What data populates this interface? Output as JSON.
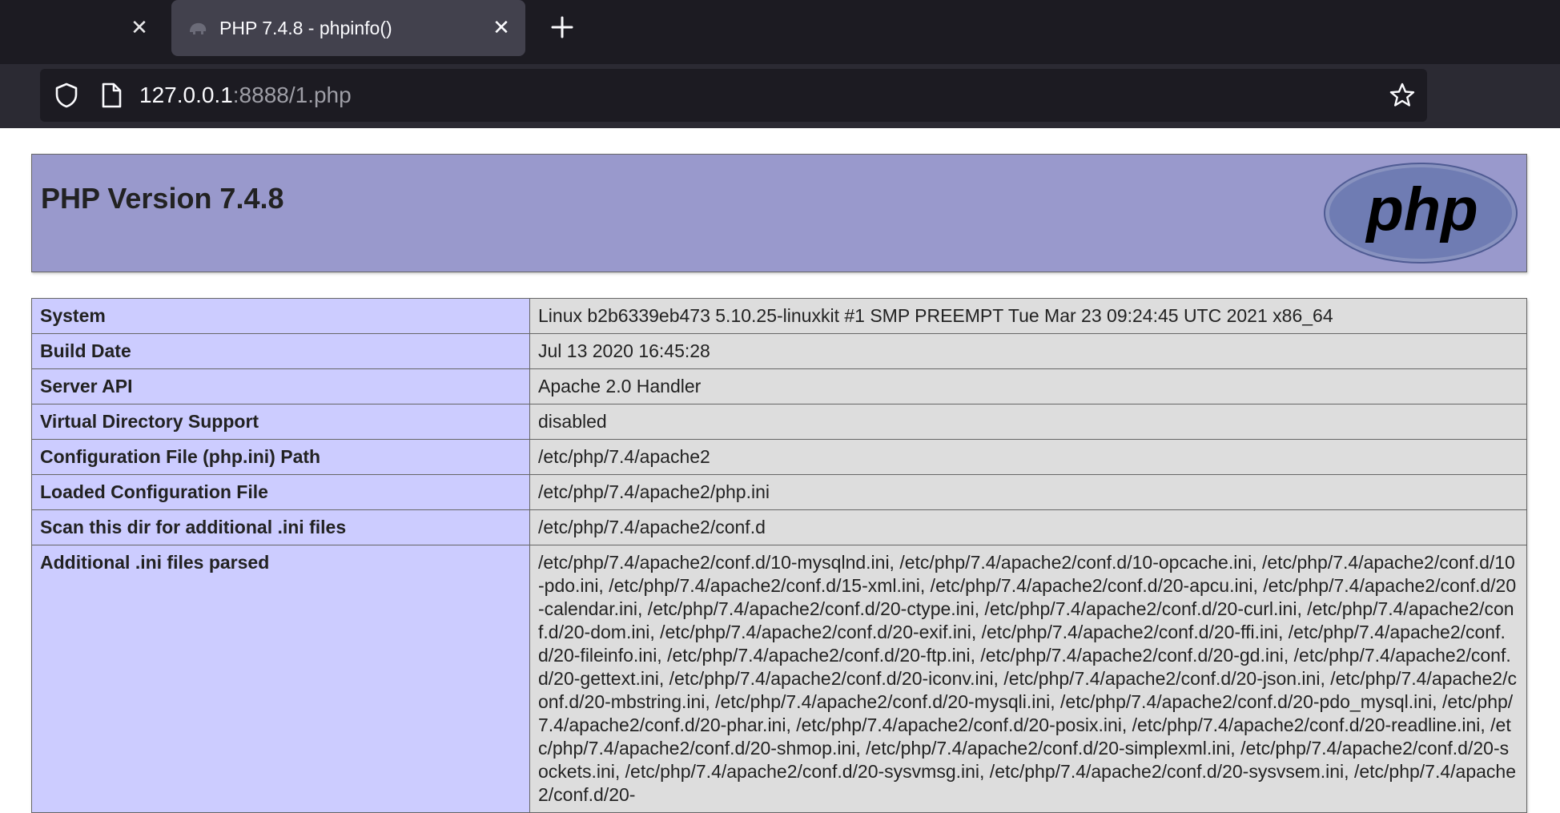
{
  "browser": {
    "tabs": [
      {
        "title": "PHP 7.4.8 - phpinfo()",
        "active": true
      }
    ],
    "url": {
      "host": "127.0.0.1",
      "rest": ":8888/1.php"
    },
    "icons": {
      "prev_tab_close": "close-icon",
      "favicon": "php-elephant-favicon",
      "tab_close": "close-icon",
      "new_tab": "plus-icon",
      "shield": "shield-icon",
      "page": "page-icon",
      "bookmark": "star-icon"
    }
  },
  "page": {
    "title": "PHP Version 7.4.8",
    "logo": "php",
    "colors": {
      "header_bg": "#9999cc",
      "label_bg": "#ccccff",
      "value_bg": "#dddddd",
      "border": "#666666",
      "logo_fill": "#6f7cb3",
      "logo_text": "#000000"
    },
    "rows": [
      {
        "label": "System",
        "value": "Linux b2b6339eb473 5.10.25-linuxkit #1 SMP PREEMPT Tue Mar 23 09:24:45 UTC 2021 x86_64"
      },
      {
        "label": "Build Date",
        "value": "Jul 13 2020 16:45:28"
      },
      {
        "label": "Server API",
        "value": "Apache 2.0 Handler"
      },
      {
        "label": "Virtual Directory Support",
        "value": "disabled"
      },
      {
        "label": "Configuration File (php.ini) Path",
        "value": "/etc/php/7.4/apache2"
      },
      {
        "label": "Loaded Configuration File",
        "value": "/etc/php/7.4/apache2/php.ini"
      },
      {
        "label": "Scan this dir for additional .ini files",
        "value": "/etc/php/7.4/apache2/conf.d"
      },
      {
        "label": "Additional .ini files parsed",
        "value": "/etc/php/7.4/apache2/conf.d/10-mysqlnd.ini, /etc/php/7.4/apache2/conf.d/10-opcache.ini, /etc/php/7.4/apache2/conf.d/10-pdo.ini, /etc/php/7.4/apache2/conf.d/15-xml.ini, /etc/php/7.4/apache2/conf.d/20-apcu.ini, /etc/php/7.4/apache2/conf.d/20-calendar.ini, /etc/php/7.4/apache2/conf.d/20-ctype.ini, /etc/php/7.4/apache2/conf.d/20-curl.ini, /etc/php/7.4/apache2/conf.d/20-dom.ini, /etc/php/7.4/apache2/conf.d/20-exif.ini, /etc/php/7.4/apache2/conf.d/20-ffi.ini, /etc/php/7.4/apache2/conf.d/20-fileinfo.ini, /etc/php/7.4/apache2/conf.d/20-ftp.ini, /etc/php/7.4/apache2/conf.d/20-gd.ini, /etc/php/7.4/apache2/conf.d/20-gettext.ini, /etc/php/7.4/apache2/conf.d/20-iconv.ini, /etc/php/7.4/apache2/conf.d/20-json.ini, /etc/php/7.4/apache2/conf.d/20-mbstring.ini, /etc/php/7.4/apache2/conf.d/20-mysqli.ini, /etc/php/7.4/apache2/conf.d/20-pdo_mysql.ini, /etc/php/7.4/apache2/conf.d/20-phar.ini, /etc/php/7.4/apache2/conf.d/20-posix.ini, /etc/php/7.4/apache2/conf.d/20-readline.ini, /etc/php/7.4/apache2/conf.d/20-shmop.ini, /etc/php/7.4/apache2/conf.d/20-simplexml.ini, /etc/php/7.4/apache2/conf.d/20-sockets.ini, /etc/php/7.4/apache2/conf.d/20-sysvmsg.ini, /etc/php/7.4/apache2/conf.d/20-sysvsem.ini, /etc/php/7.4/apache2/conf.d/20-"
      }
    ]
  }
}
